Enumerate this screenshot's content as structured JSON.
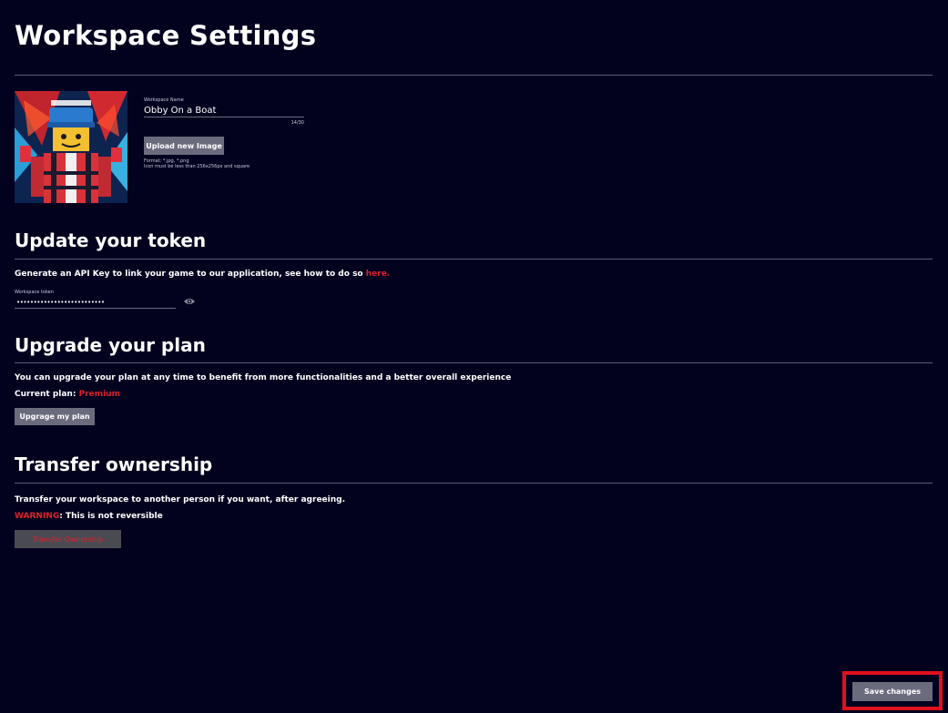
{
  "page": {
    "title": "Workspace Settings"
  },
  "workspace": {
    "name_label": "Workspace Name",
    "name_value": "Obby On a Boat",
    "char_count": "14/30",
    "upload_label": "Upload new Image",
    "format_line": "Format: *.jpg, *.png",
    "size_line": "Icon must be less than 256x256px and square",
    "avatar_icon": "workspace-avatar-image"
  },
  "token": {
    "heading": "Update your token",
    "description": "Generate an API Key to link your game to our application, see how to do so ",
    "link_text": "here.",
    "field_label": "Workspace token",
    "masked_value": "••••••••••••••••••••••••••",
    "toggle_icon": "eye-icon"
  },
  "plan": {
    "heading": "Upgrade your plan",
    "description": "You can upgrade your plan at any time to benefit from more functionalities and a better overall experience",
    "current_label": "Current plan: ",
    "current_value": "Premium",
    "upgrade_label": "Upgrage my plan"
  },
  "transfer": {
    "heading": "Transfer ownership",
    "description": "Transfer your workspace to another person if you want, after agreeing.",
    "warning_label": "WARNING",
    "warning_text": ": This is not reversible",
    "button_label": "Transfer Ownership"
  },
  "footer": {
    "save_label": "Save changes"
  },
  "colors": {
    "background": "#02021f",
    "accent_red": "#e0202a",
    "button_gray": "#6b6b7e"
  }
}
